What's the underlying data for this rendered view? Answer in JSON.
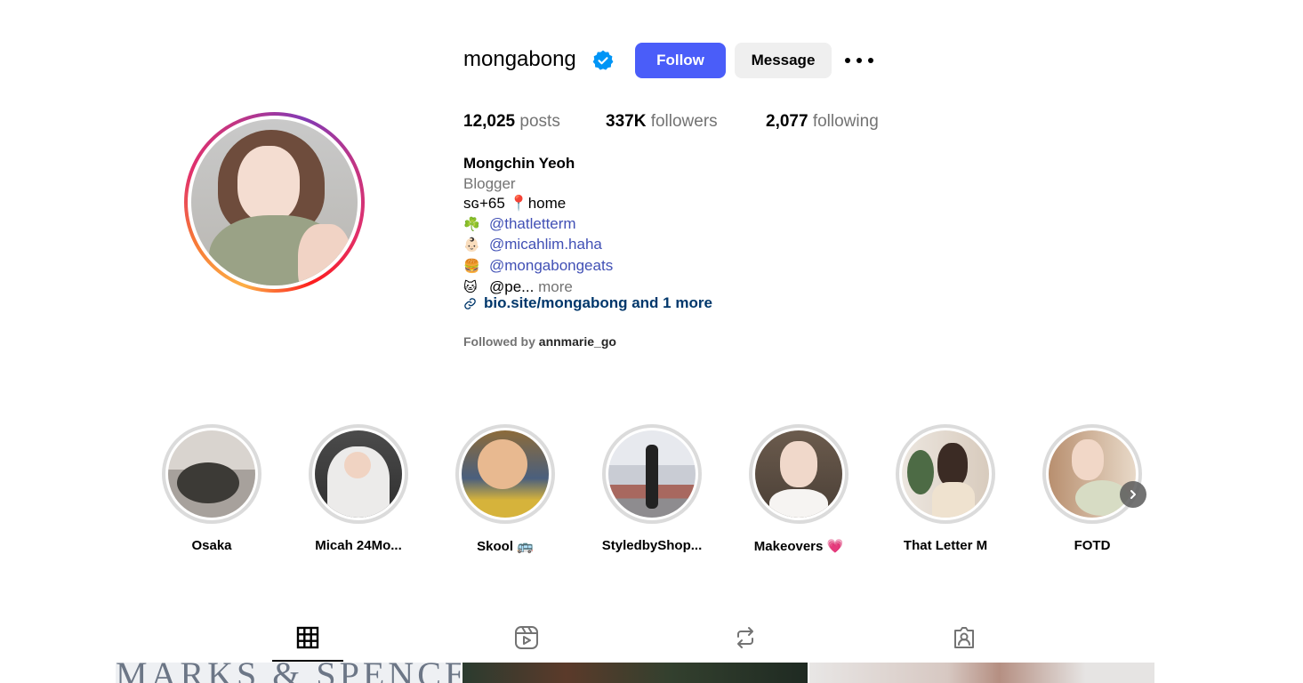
{
  "profile": {
    "username": "mongabong",
    "follow_label": "Follow",
    "message_label": "Message",
    "posts_count": "12,025",
    "posts_label": "posts",
    "followers_count": "337K",
    "followers_label": "followers",
    "following_count": "2,077",
    "following_label": "following",
    "full_name": "Mongchin Yeoh",
    "category": "Blogger",
    "bio_line1": "sɢ+65 📍home",
    "mentions": [
      {
        "emoji": "☘️",
        "handle": "@thatletterm"
      },
      {
        "emoji": "👶🏻",
        "handle": "@micahlim.haha"
      },
      {
        "emoji": "🍔",
        "handle": "@mongabongeats"
      }
    ],
    "truncated_emoji": "🐱",
    "truncated_text": "@pe...",
    "more_label": "more",
    "link_text": "bio.site/mongabong and 1 more",
    "followed_by_prefix": "Followed by",
    "followed_by_user": "annmarie_go"
  },
  "highlights": [
    {
      "label": "Osaka"
    },
    {
      "label": "Micah 24Mo..."
    },
    {
      "label": "Skool 🚌"
    },
    {
      "label": "StyledbyShop..."
    },
    {
      "label": "Makeovers 💗"
    },
    {
      "label": "That Letter M"
    },
    {
      "label": "FOTD"
    }
  ],
  "grid_preview": {
    "cell1_text": "MARKS & SPENCER"
  },
  "colors": {
    "follow_button": "#4a5df9",
    "mention": "#4150b5",
    "link": "#00376b",
    "verified": "#0095f6"
  }
}
